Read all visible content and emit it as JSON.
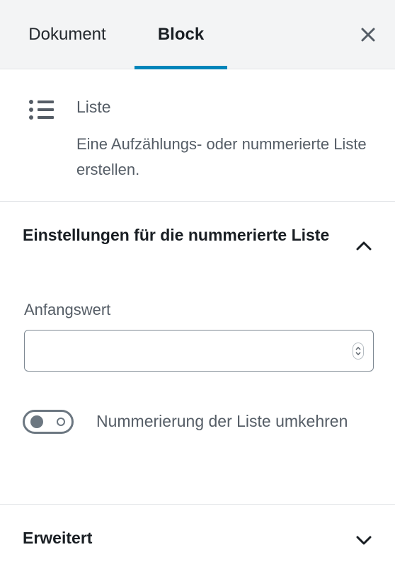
{
  "tabs": [
    {
      "label": "Dokument",
      "active": false
    },
    {
      "label": "Block",
      "active": true
    }
  ],
  "close_icon": "close-icon",
  "block_card": {
    "icon": "list-icon",
    "title": "Liste",
    "description": "Eine Aufzählungs- oder nummerierte Liste erstellen."
  },
  "numbered_list_panel": {
    "title": "Einstellungen für die nummerierte Liste",
    "expanded": true,
    "start_value": {
      "label": "Anfangswert",
      "value": "",
      "placeholder": ""
    },
    "reverse_toggle": {
      "label": "Nummerierung der Liste umkehren",
      "checked": false
    }
  },
  "advanced_panel": {
    "title": "Erweitert",
    "expanded": false
  },
  "colors": {
    "accent": "#0085ba",
    "tab_bar_bg": "#f3f4f5",
    "muted_text": "#555d66"
  }
}
